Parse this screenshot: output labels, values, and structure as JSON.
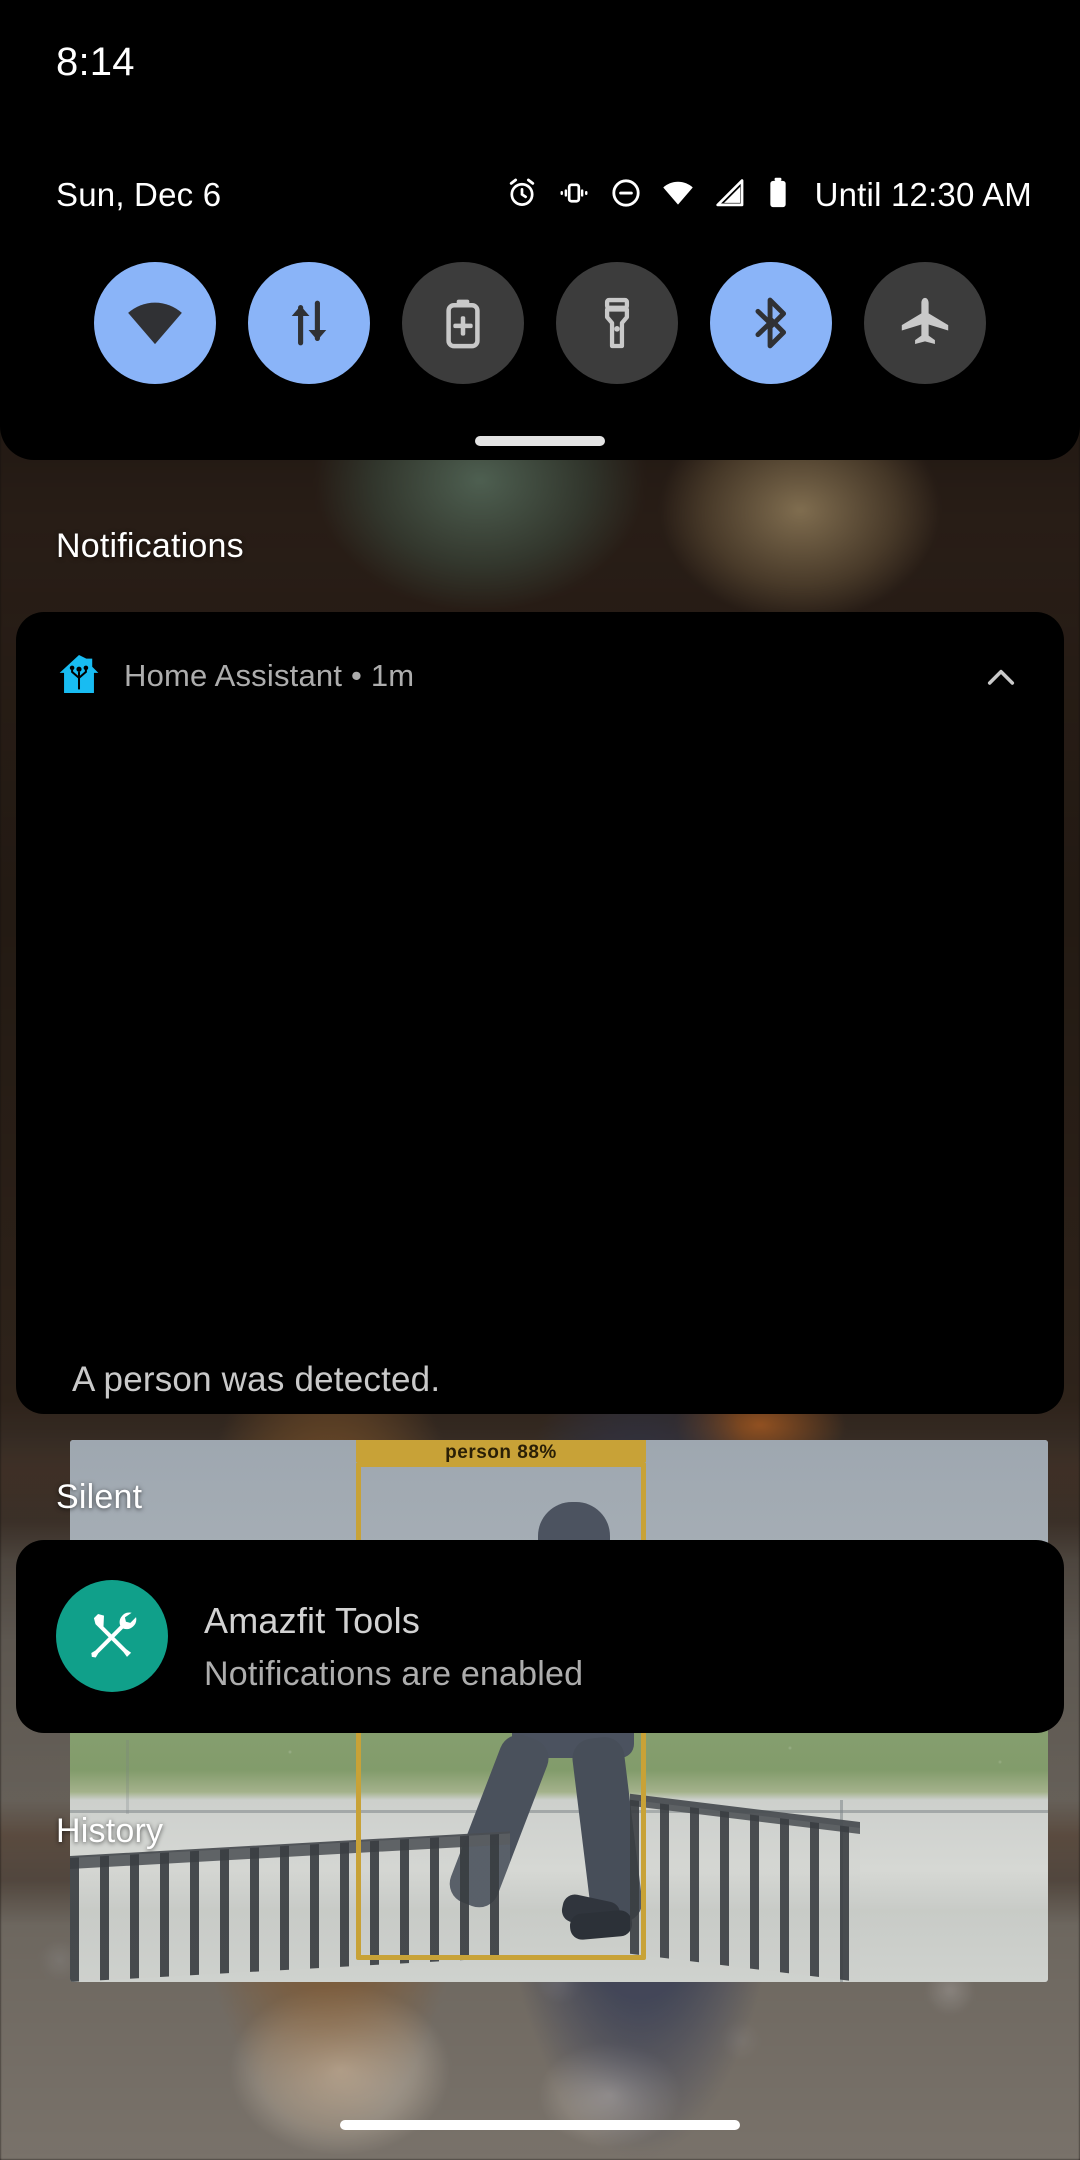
{
  "statusbar": {
    "clock": "8:14",
    "date": "Sun, Dec 6",
    "dnd_until": "Until 12:30 AM",
    "icons": [
      {
        "name": "alarm-icon",
        "label": "Alarm set"
      },
      {
        "name": "vibrate-icon",
        "label": "Ringer vibrate"
      },
      {
        "name": "do-not-disturb-icon",
        "label": "Do not disturb"
      },
      {
        "name": "wifi-icon",
        "label": "Wi-Fi connected"
      },
      {
        "name": "cell-signal-icon",
        "label": "Mobile signal"
      },
      {
        "name": "battery-icon",
        "label": "Battery"
      }
    ]
  },
  "quick_settings": {
    "tiles": [
      {
        "name": "wifi-tile",
        "label": "Wi-Fi",
        "icon": "wifi-icon",
        "active": true
      },
      {
        "name": "mobile-data-tile",
        "label": "Mobile data",
        "icon": "data-arrows-icon",
        "active": true
      },
      {
        "name": "battery-saver-tile",
        "label": "Battery Saver",
        "icon": "battery-plus-icon",
        "active": false
      },
      {
        "name": "flashlight-tile",
        "label": "Flashlight",
        "icon": "flashlight-icon",
        "active": false
      },
      {
        "name": "bluetooth-tile",
        "label": "Bluetooth",
        "icon": "bluetooth-icon",
        "active": true
      },
      {
        "name": "airplane-tile",
        "label": "Airplane mode",
        "icon": "airplane-icon",
        "active": false
      }
    ],
    "active_color": "#8AB4F8",
    "inactive_color": "#3C3C3C",
    "icon_on_color": "#303134",
    "icon_off_color": "#C9C9C9"
  },
  "sections": {
    "notifications_label": "Notifications",
    "silent_label": "Silent",
    "history_label": "History"
  },
  "notifications": [
    {
      "id": "home-assistant",
      "app_name": "Home Assistant",
      "time": "1m",
      "header": "Home Assistant • 1m",
      "body": "A person was detected.",
      "collapse_icon": "chevron-up-icon",
      "app_icon": "home-assistant-icon",
      "app_icon_color": "#18BCF2",
      "image": {
        "name": "camera-snapshot",
        "description": "Security camera snapshot of a person in a dark hooded jacket and beanie walking along a sidewalk past a fence and grass strip",
        "detection_box_color": "#C8A237",
        "detection_label": "person 88%"
      }
    },
    {
      "id": "amazfit-tools",
      "app_name": "Amazfit Tools",
      "title": "Amazfit Tools",
      "body": "Notifications are enabled",
      "app_icon": "tools-icon",
      "app_icon_color": "#10A08A"
    }
  ],
  "gesture_bar": {
    "name": "home-gesture-bar"
  }
}
